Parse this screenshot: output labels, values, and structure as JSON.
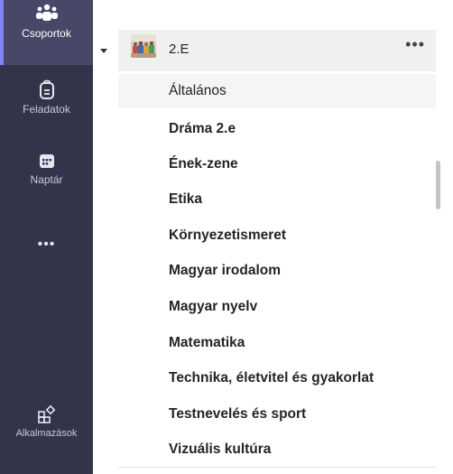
{
  "rail": {
    "groups": {
      "label": "Csoportok",
      "icon": "teams-icon"
    },
    "tasks": {
      "label": "Feladatok",
      "icon": "backpack-icon"
    },
    "calendar": {
      "label": "Naptár",
      "icon": "calendar-icon"
    },
    "more": {
      "label": "•••",
      "icon": "more-icon"
    },
    "apps": {
      "label": "Alkalmazások",
      "icon": "apps-icon"
    }
  },
  "team": {
    "name": "2.E",
    "more_label": "•••",
    "channels": [
      {
        "label": "Általános",
        "selected": true,
        "bold": false
      },
      {
        "label": "Dráma 2.e",
        "selected": false,
        "bold": true
      },
      {
        "label": "Ének-zene",
        "selected": false,
        "bold": true
      },
      {
        "label": "Etika",
        "selected": false,
        "bold": true
      },
      {
        "label": "Környezetismeret",
        "selected": false,
        "bold": true
      },
      {
        "label": "Magyar irodalom",
        "selected": false,
        "bold": true
      },
      {
        "label": "Magyar nyelv",
        "selected": false,
        "bold": true
      },
      {
        "label": "Matematika",
        "selected": false,
        "bold": true
      },
      {
        "label": "Technika, életvitel és gyakorlat",
        "selected": false,
        "bold": true
      },
      {
        "label": "Testnevelés és sport",
        "selected": false,
        "bold": true
      },
      {
        "label": "Vizuális kultúra",
        "selected": false,
        "bold": true
      }
    ]
  },
  "colors": {
    "rail_bg": "#33344a",
    "rail_active": "#474867",
    "accent": "#7f85f5"
  }
}
